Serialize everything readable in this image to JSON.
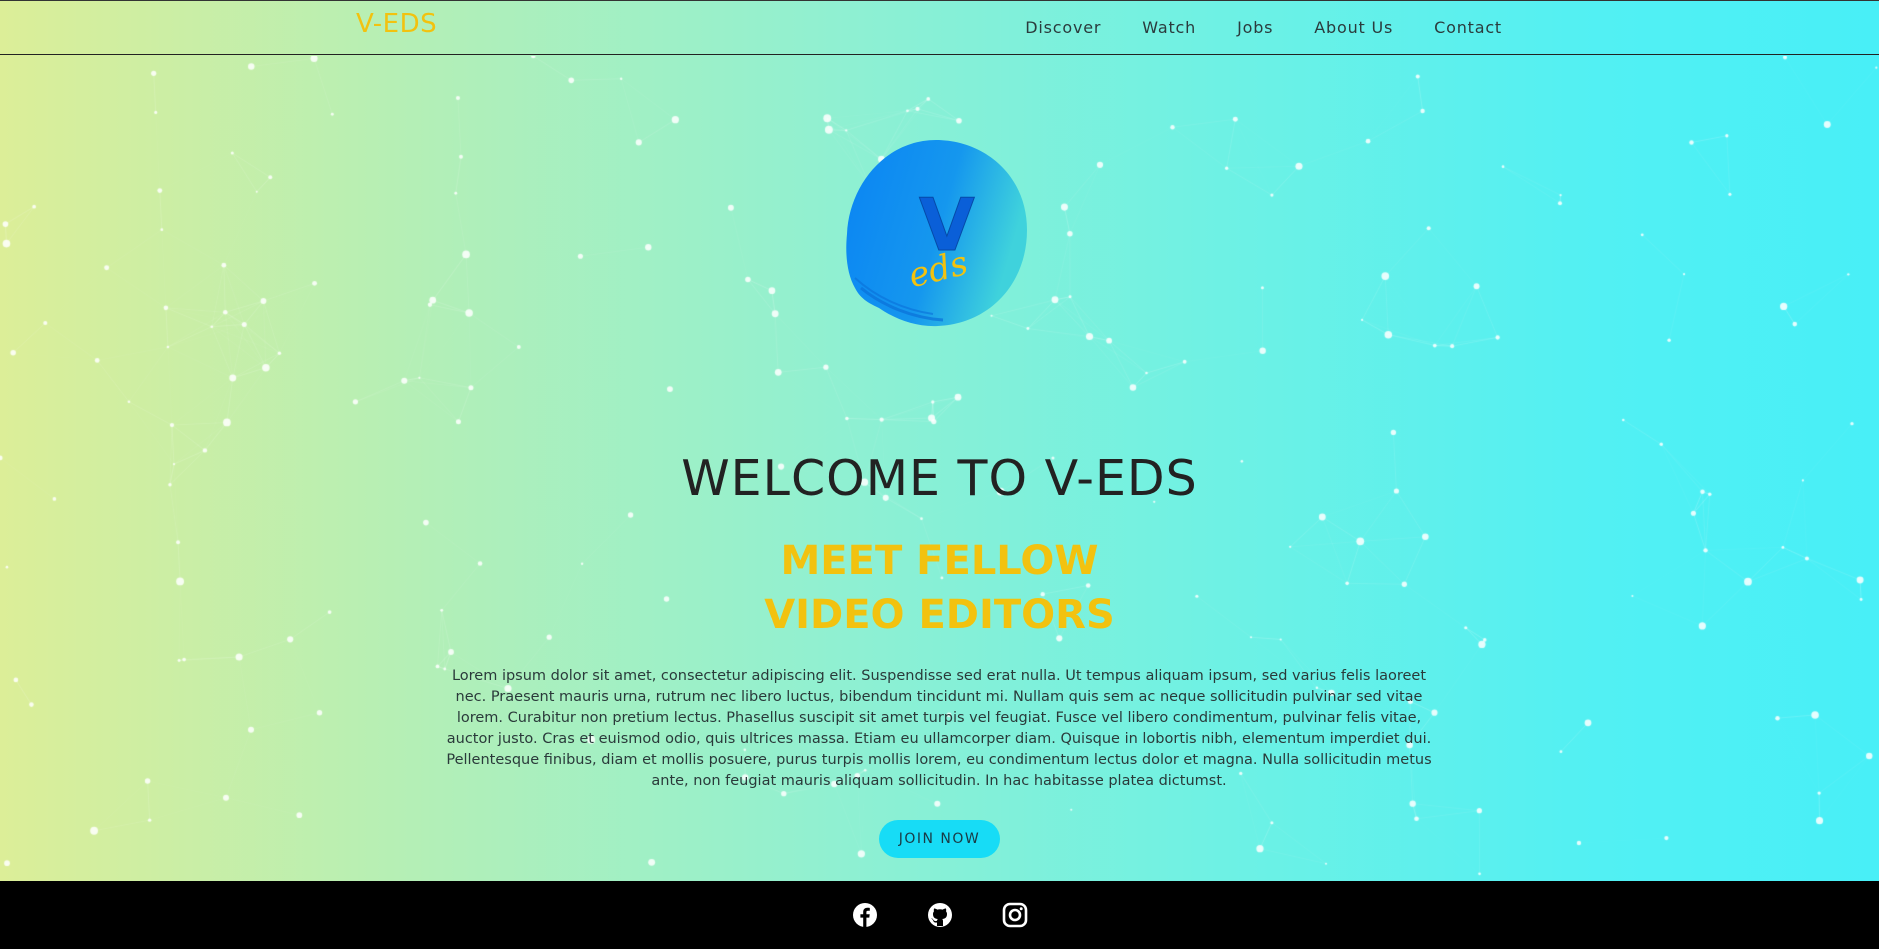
{
  "navbar": {
    "brand": "V-EDS",
    "links": [
      "Discover",
      "Watch",
      "Jobs",
      "About Us",
      "Contact"
    ]
  },
  "hero": {
    "logo_letter": "V",
    "logo_script": "eds",
    "title": "WELCOME TO V-EDS",
    "subtitle_line1": "MEET FELLOW",
    "subtitle_line2": "VIDEO EDITORS",
    "body": "Lorem ipsum dolor sit amet, consectetur adipiscing elit. Suspendisse sed erat nulla. Ut tempus aliquam ipsum, sed varius felis laoreet nec. Praesent mauris urna, rutrum nec libero luctus, bibendum tincidunt mi. Nullam quis sem ac neque sollicitudin pulvinar sed vitae lorem. Curabitur non pretium lectus. Phasellus suscipit sit amet turpis vel feugiat. Fusce vel libero condimentum, pulvinar felis vitae, auctor justo. Cras et euismod odio, quis ultrices massa. Etiam eu ullamcorper diam. Quisque in lobortis nibh, elementum imperdiet dui. Pellentesque finibus, diam et mollis posuere, purus turpis mollis lorem, eu condimentum lectus dolor et magna. Nulla sollicitudin metus ante, non feugiat mauris aliquam sollicitudin. In hac habitasse platea dictumst.",
    "cta": "JOIN NOW"
  },
  "footer": {
    "icons": [
      "facebook-icon",
      "github-icon",
      "instagram-icon"
    ]
  },
  "colors": {
    "brand_yellow": "#f2c20f",
    "cta_cyan": "#17dcf6",
    "footer_bg": "#000000",
    "logo_blue": "#0a84f4"
  }
}
